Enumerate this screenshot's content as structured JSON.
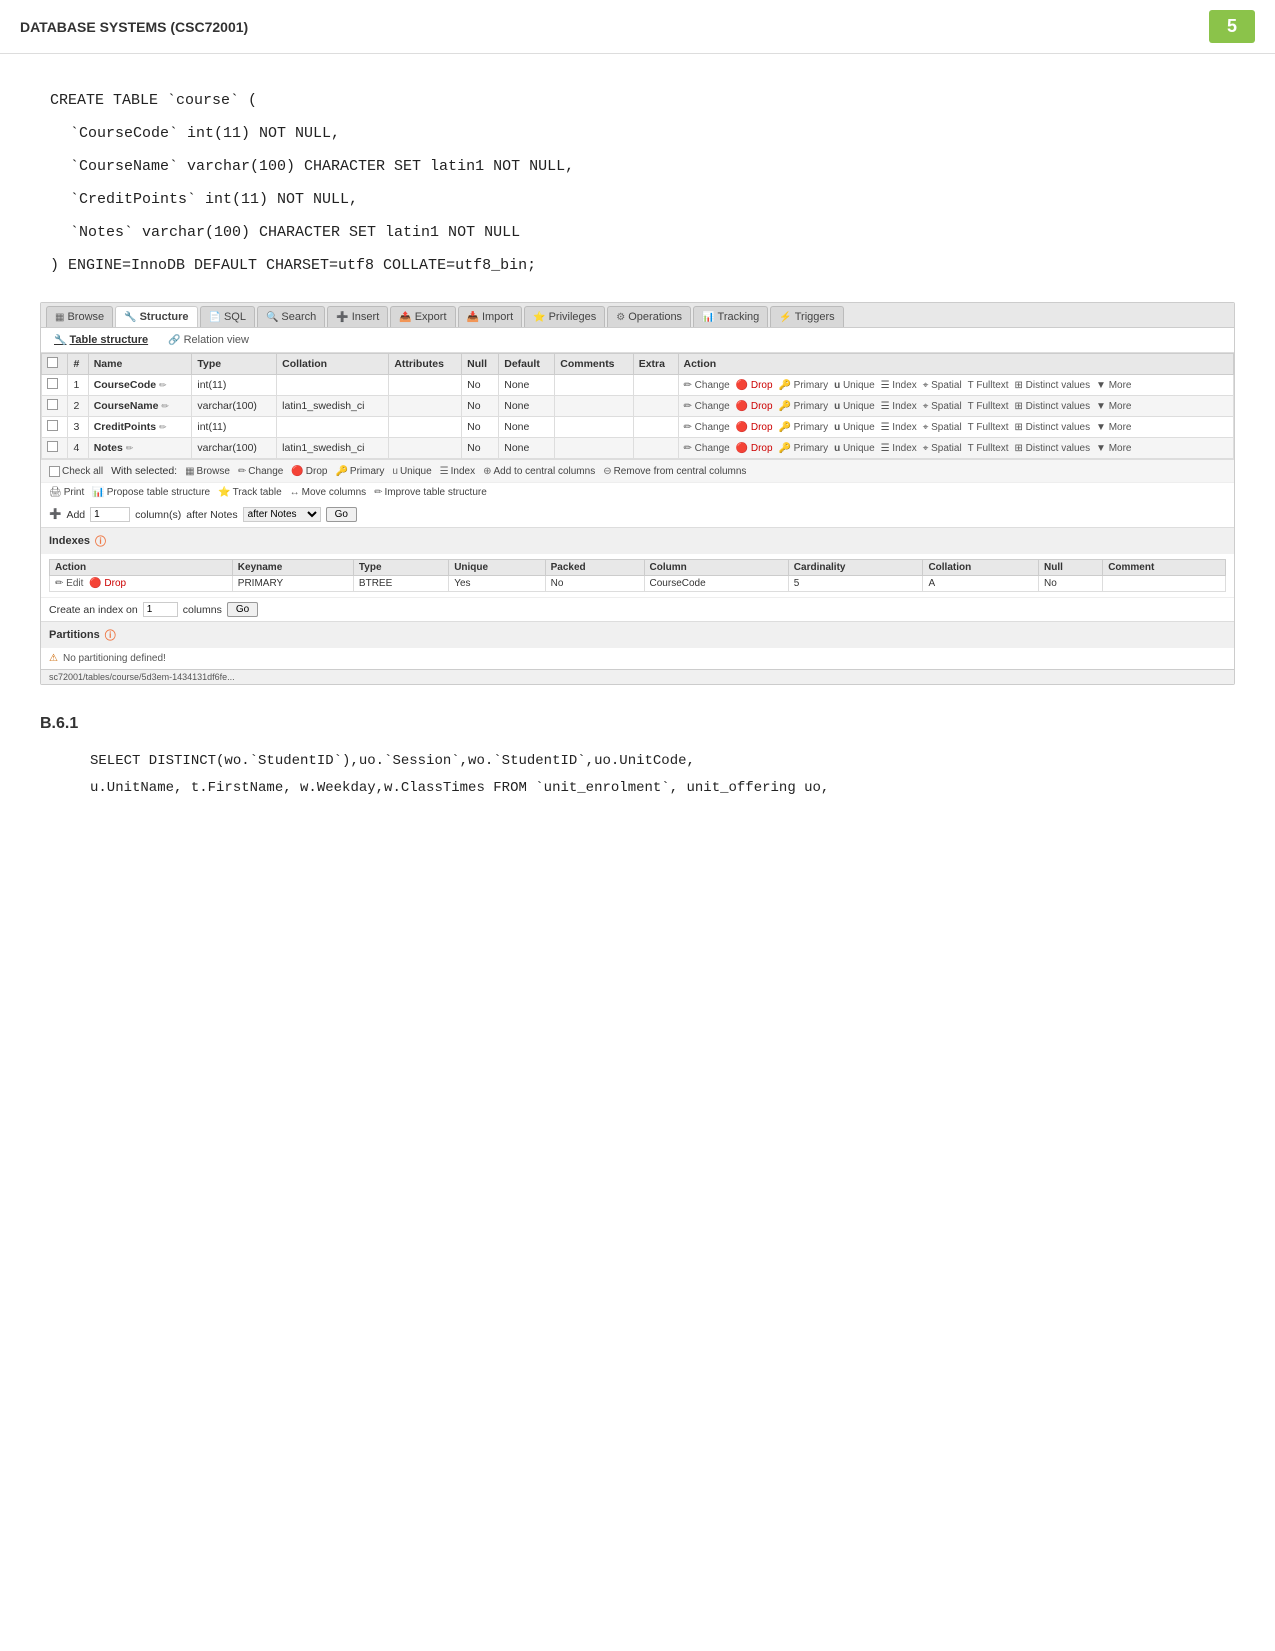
{
  "header": {
    "title": "DATABASE SYSTEMS (CSC72001)",
    "page_num": "5"
  },
  "sql_create": {
    "lines": [
      "CREATE TABLE `course` (",
      "  `CourseCode` int(11) NOT NULL,",
      "  `CourseName` varchar(100) CHARACTER SET latin1 NOT NULL,",
      "  `CreditPoints` int(11) NOT NULL,",
      "  `Notes` varchar(100) CHARACTER SET latin1 NOT NULL",
      ") ENGINE=InnoDB DEFAULT CHARSET=utf8 COLLATE=utf8_bin;"
    ]
  },
  "phpmyadmin": {
    "tabs": [
      {
        "id": "browse",
        "label": "Browse",
        "icon": "🔍"
      },
      {
        "id": "structure",
        "label": "Structure",
        "icon": "🔧",
        "active": true
      },
      {
        "id": "sql",
        "label": "SQL",
        "icon": "📄"
      },
      {
        "id": "search",
        "label": "Search",
        "icon": "🔍"
      },
      {
        "id": "insert",
        "label": "Insert",
        "icon": "➕"
      },
      {
        "id": "export",
        "label": "Export",
        "icon": "📤"
      },
      {
        "id": "import",
        "label": "Import",
        "icon": "📥"
      },
      {
        "id": "privileges",
        "label": "Privileges",
        "icon": "🔑"
      },
      {
        "id": "operations",
        "label": "Operations",
        "icon": "⚙"
      },
      {
        "id": "tracking",
        "label": "Tracking",
        "icon": "📊"
      },
      {
        "id": "triggers",
        "label": "Triggers",
        "icon": "⚡"
      }
    ],
    "sub_tabs": [
      {
        "id": "table_structure",
        "label": "Table structure",
        "icon": "🔧",
        "active": true
      },
      {
        "id": "relation_view",
        "label": "Relation view",
        "icon": "🔗"
      }
    ],
    "columns": [
      {
        "header": "#"
      },
      {
        "header": "Name"
      },
      {
        "header": "Type"
      },
      {
        "header": "Collation"
      },
      {
        "header": "Attributes"
      },
      {
        "header": "Null"
      },
      {
        "header": "Default"
      },
      {
        "header": "Comments"
      },
      {
        "header": "Extra"
      },
      {
        "header": "Action"
      }
    ],
    "rows": [
      {
        "num": "1",
        "name": "CourseCode",
        "type": "int(11)",
        "collation": "",
        "attributes": "",
        "null": "No",
        "default": "None",
        "comments": "",
        "extra": "",
        "actions": "Change  Drop  Primary  Unique  Index  Spatial  Fulltext  Distinct values  More"
      },
      {
        "num": "2",
        "name": "CourseName",
        "type": "varchar(100)",
        "collation": "latin1_swedish_ci",
        "attributes": "",
        "null": "No",
        "default": "None",
        "comments": "",
        "extra": "",
        "actions": "Change  Drop  Primary  Unique  Index  Spatial  Fulltext  Distinct values  More"
      },
      {
        "num": "3",
        "name": "CreditPoints",
        "type": "int(11)",
        "collation": "",
        "attributes": "",
        "null": "No",
        "default": "None",
        "comments": "",
        "extra": "",
        "actions": "Change  Drop  Primary  Unique  Index  Spatial  Fulltext  Distinct values  More"
      },
      {
        "num": "4",
        "name": "Notes",
        "type": "varchar(100)",
        "collation": "latin1_swedish_ci",
        "attributes": "",
        "null": "No",
        "default": "None",
        "comments": "",
        "extra": "",
        "actions": "Change  Drop  Primary  Unique  Index  Spatial  Fulltext  Distinct values  More"
      }
    ],
    "bottom_actions": {
      "check_all_label": "Check all",
      "with_selected_label": "With selected:",
      "browse_label": "Browse",
      "change_label": "Change",
      "drop_label": "Drop",
      "primary_label": "Primary",
      "unique_label": "Unique",
      "index_label": "Index",
      "add_central_label": "Add to central columns",
      "remove_central_label": "Remove from central columns"
    },
    "print_actions": {
      "print_label": "Print",
      "propose_label": "Propose table structure",
      "track_label": "Track table",
      "move_label": "Move columns",
      "improve_label": "Improve table structure"
    },
    "add_bar": {
      "add_label": "Add",
      "column_label": "column(s)",
      "after_label": "after Notes",
      "go_label": "Go"
    },
    "indexes": {
      "title": "Indexes",
      "columns": [
        "Action",
        "Keyname",
        "Type",
        "Unique",
        "Packed",
        "Column",
        "Cardinality",
        "Collation",
        "Null",
        "Comment"
      ],
      "rows": [
        {
          "action": "Edit  Drop",
          "keyname": "PRIMARY",
          "type": "BTREE",
          "unique": "Yes",
          "packed": "No",
          "column": "CourseCode",
          "cardinality": "5",
          "collation": "A",
          "null": "No",
          "comment": ""
        }
      ],
      "create_index": {
        "label": "Create an index on",
        "num": "1",
        "columns_label": "columns",
        "go_label": "Go"
      }
    },
    "partitions": {
      "title": "Partitions",
      "no_partitioning_label": "No partitioning defined!"
    },
    "url": "sc72001/tables/course/5d3em-1434131df6fe..."
  },
  "section_b61": {
    "title": "B.6.1",
    "query_line1": "SELECT         DISTINCT(wo.`StudentID`),uo.`Session`,wo.`StudentID`,uo.UnitCode,",
    "query_line2": "u.UnitName, t.FirstName, w.Weekday,w.ClassTimes FROM `unit_enrolment`, unit_offering uo,"
  }
}
